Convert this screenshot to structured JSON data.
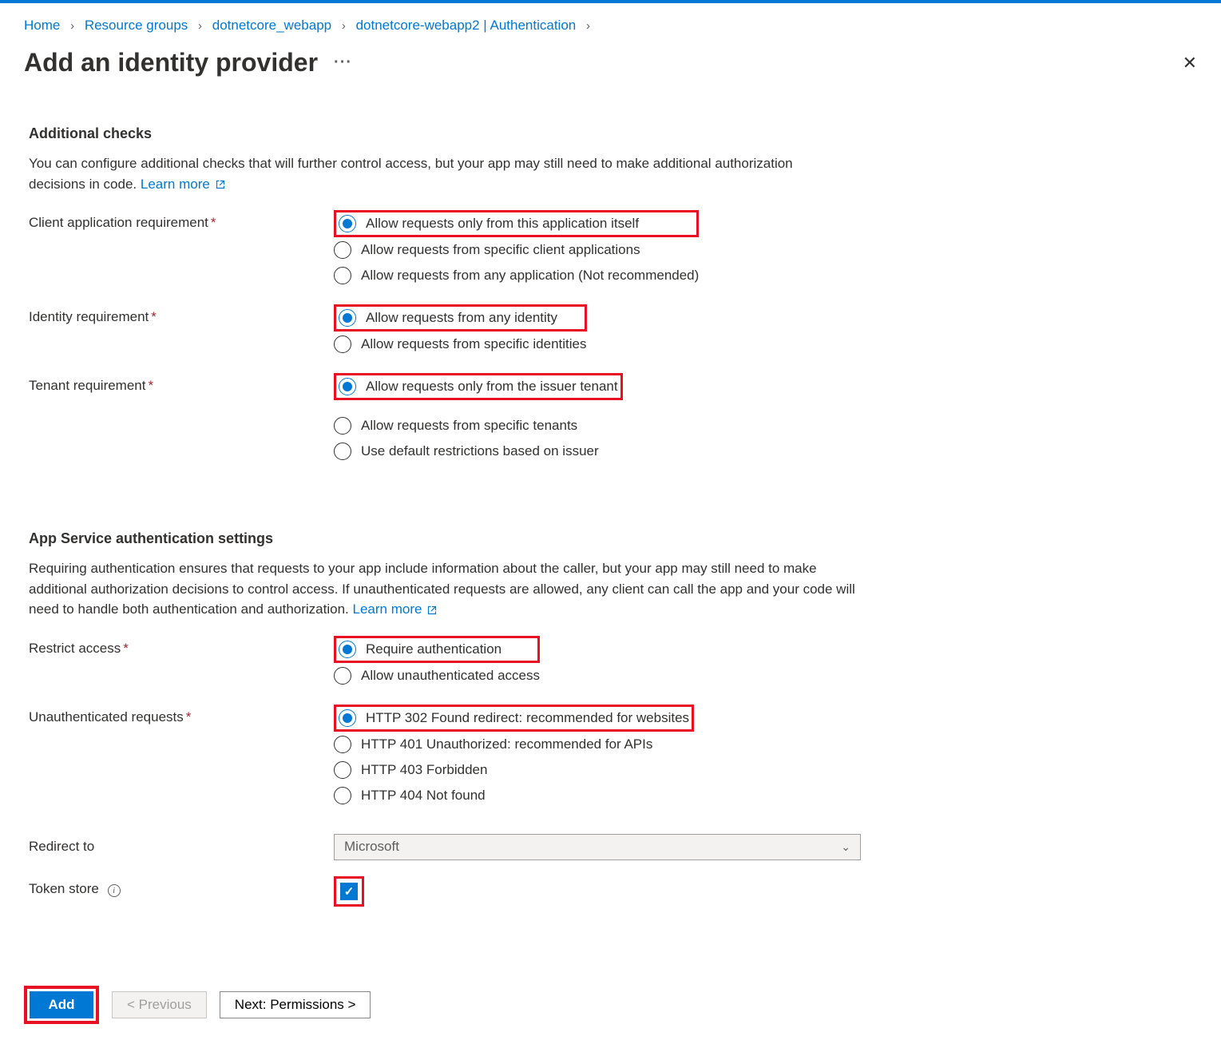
{
  "breadcrumb": {
    "items": [
      "Home",
      "Resource groups",
      "dotnetcore_webapp",
      "dotnetcore-webapp2 | Authentication"
    ]
  },
  "page_title": "Add an identity provider",
  "section1": {
    "heading": "Additional checks",
    "desc_part1": "You can configure additional checks that will further control access, but your app may still need to make additional authorization decisions in code. ",
    "learn_more": "Learn more"
  },
  "client_app_req": {
    "label": "Client application requirement",
    "opt1": "Allow requests only from this application itself",
    "opt2": "Allow requests from specific client applications",
    "opt3": "Allow requests from any application (Not recommended)"
  },
  "identity_req": {
    "label": "Identity requirement",
    "opt1": "Allow requests from any identity",
    "opt2": "Allow requests from specific identities"
  },
  "tenant_req": {
    "label": "Tenant requirement",
    "opt1": "Allow requests only from the issuer tenant",
    "opt2": "Allow requests from specific tenants",
    "opt3": "Use default restrictions based on issuer"
  },
  "section2": {
    "heading": "App Service authentication settings",
    "desc_part1": "Requiring authentication ensures that requests to your app include information about the caller, but your app may still need to make additional authorization decisions to control access. If unauthenticated requests are allowed, any client can call the app and your code will need to handle both authentication and authorization. ",
    "learn_more": "Learn more"
  },
  "restrict_access": {
    "label": "Restrict access",
    "opt1": "Require authentication",
    "opt2": "Allow unauthenticated access"
  },
  "unauth_requests": {
    "label": "Unauthenticated requests",
    "opt1": "HTTP 302 Found redirect: recommended for websites",
    "opt2": "HTTP 401 Unauthorized: recommended for APIs",
    "opt3": "HTTP 403 Forbidden",
    "opt4": "HTTP 404 Not found"
  },
  "redirect_to": {
    "label": "Redirect to",
    "value": "Microsoft"
  },
  "token_store": {
    "label": "Token store"
  },
  "footer": {
    "add": "Add",
    "previous": "<  Previous",
    "next": "Next: Permissions  >"
  }
}
